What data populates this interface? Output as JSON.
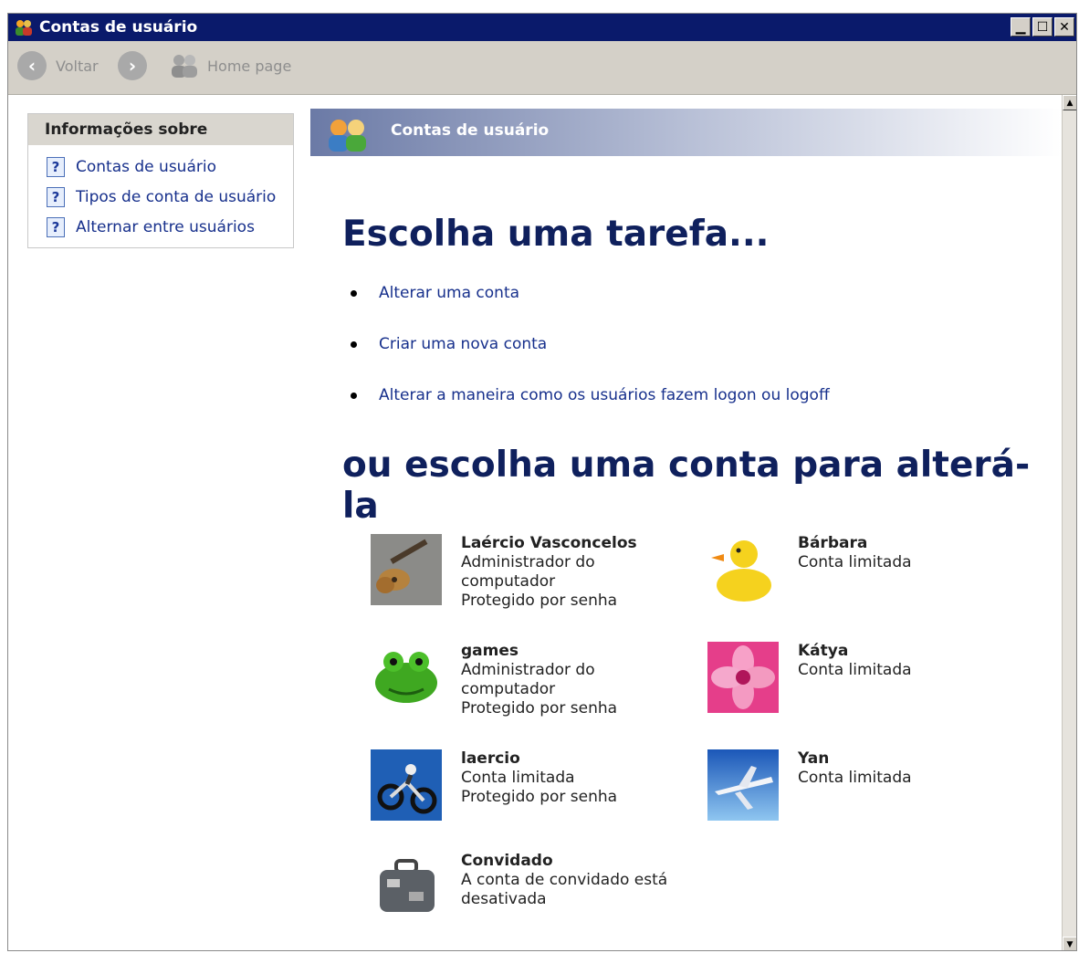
{
  "window": {
    "title": "Contas de usuário",
    "controls": [
      "minimize",
      "maximize",
      "close"
    ]
  },
  "toolbar": {
    "back_label": "Voltar",
    "home_label": "Home page"
  },
  "sidebar": {
    "heading": "Informações sobre",
    "items": [
      {
        "label": "Contas de usuário"
      },
      {
        "label": "Tipos de conta de usuário"
      },
      {
        "label": "Alternar entre usuários"
      }
    ]
  },
  "banner": {
    "title": "Contas de usuário"
  },
  "main": {
    "task_heading": "Escolha uma tarefa...",
    "tasks": [
      {
        "label": "Alterar uma conta"
      },
      {
        "label": "Criar uma nova conta"
      },
      {
        "label": "Alterar a maneira como os usuários fazem logon ou logoff"
      }
    ],
    "account_heading": "ou escolha uma conta para alterá-la",
    "accounts": [
      {
        "name": "Laércio Vasconcelos",
        "lines": [
          "Administrador do",
          "computador",
          "Protegido por senha"
        ],
        "picture": "guitar"
      },
      {
        "name": "Bárbara",
        "lines": [
          "Conta limitada"
        ],
        "picture": "duck"
      },
      {
        "name": "games",
        "lines": [
          "Administrador do",
          "computador",
          "Protegido por senha"
        ],
        "picture": "frog"
      },
      {
        "name": "Kátya",
        "lines": [
          "Conta limitada"
        ],
        "picture": "flower"
      },
      {
        "name": "laercio",
        "lines": [
          "Conta limitada",
          "Protegido por senha"
        ],
        "picture": "motorbike"
      },
      {
        "name": "Yan",
        "lines": [
          "Conta limitada"
        ],
        "picture": "airplane"
      },
      {
        "name": "Convidado",
        "lines": [
          "A conta de convidado está",
          "desativada"
        ],
        "picture": "suitcase"
      }
    ]
  },
  "colors": {
    "title_bar": "#0a1a6b",
    "link": "#17308c",
    "heading": "#0f205d"
  }
}
